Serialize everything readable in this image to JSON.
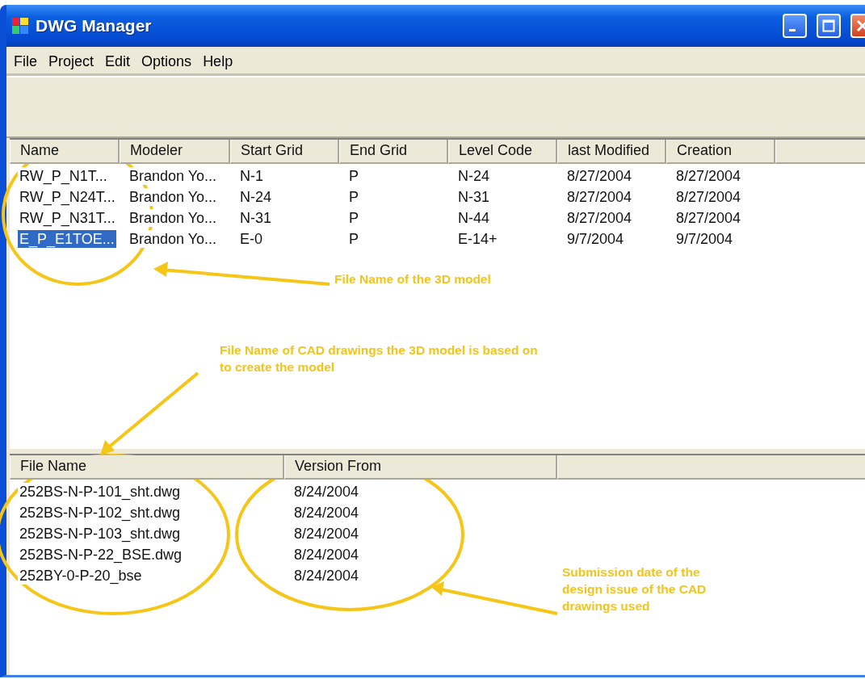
{
  "window": {
    "title": "DWG Manager"
  },
  "menu": [
    "File",
    "Project",
    "Edit",
    "Options",
    "Help"
  ],
  "models": {
    "columns": [
      "Name",
      "Modeler",
      "Start Grid",
      "End Grid",
      "Level Code",
      "last Modified",
      "Creation"
    ],
    "rows": [
      {
        "cells": [
          "RW_P_N1T...",
          "Brandon Yo...",
          "N-1",
          "P",
          "N-24",
          "8/27/2004",
          "8/27/2004"
        ],
        "selected": false
      },
      {
        "cells": [
          "RW_P_N24T...",
          "Brandon Yo...",
          "N-24",
          "P",
          "N-31",
          "8/27/2004",
          "8/27/2004"
        ],
        "selected": false
      },
      {
        "cells": [
          "RW_P_N31T...",
          "Brandon Yo...",
          "N-31",
          "P",
          "N-44",
          "8/27/2004",
          "8/27/2004"
        ],
        "selected": false
      },
      {
        "cells": [
          "E_P_E1TOE...",
          "Brandon Yo...",
          "E-0",
          "P",
          "E-14+",
          "9/7/2004",
          "9/7/2004"
        ],
        "selected": true
      }
    ]
  },
  "drawings": {
    "columns": [
      "File Name",
      "Version From"
    ],
    "rows": [
      {
        "cells": [
          "252BS-N-P-101_sht.dwg",
          "8/24/2004"
        ],
        "selected": false
      },
      {
        "cells": [
          "252BS-N-P-102_sht.dwg",
          "8/24/2004"
        ],
        "selected": false
      },
      {
        "cells": [
          "252BS-N-P-103_sht.dwg",
          "8/24/2004"
        ],
        "selected": false
      },
      {
        "cells": [
          "252BS-N-P-22_BSE.dwg",
          "8/24/2004"
        ],
        "selected": false
      },
      {
        "cells": [
          "252BY-0-P-20_bse",
          "8/24/2004"
        ],
        "selected": false
      }
    ]
  },
  "annotations": [
    {
      "text": "File Name of the 3D model"
    },
    {
      "text": "File Name of CAD drawings the 3D model is based on to create the model"
    },
    {
      "text": "Submission date of the design issue of the CAD drawings used"
    }
  ]
}
